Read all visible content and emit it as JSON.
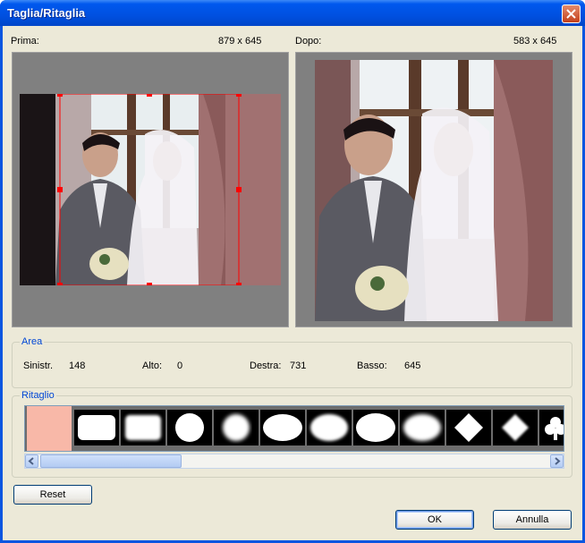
{
  "window": {
    "title": "Taglia/Ritaglia"
  },
  "before": {
    "label": "Prima:",
    "size": "879 x 645"
  },
  "after": {
    "label": "Dopo:",
    "size": "583 x 645"
  },
  "area": {
    "title": "Area",
    "left_label": "Sinistr.",
    "left_value": "148",
    "top_label": "Alto:",
    "top_value": "0",
    "right_label": "Destra:",
    "right_value": "731",
    "bottom_label": "Basso:",
    "bottom_value": "645"
  },
  "crop": {
    "title": "Ritaglio",
    "shapes": [
      "none",
      "rounded-rectangle",
      "soft-rectangle",
      "circle",
      "soft-circle",
      "ellipse",
      "soft-ellipse",
      "soft-rounded-ellipse",
      "soft-oval",
      "diamond",
      "soft-diamond",
      "club"
    ]
  },
  "buttons": {
    "reset": "Reset",
    "ok": "OK",
    "cancel": "Annulla"
  },
  "colors": {
    "title_bar": "#0054e3",
    "accent": "#0046d5",
    "crop_handles": "#ff0000"
  }
}
